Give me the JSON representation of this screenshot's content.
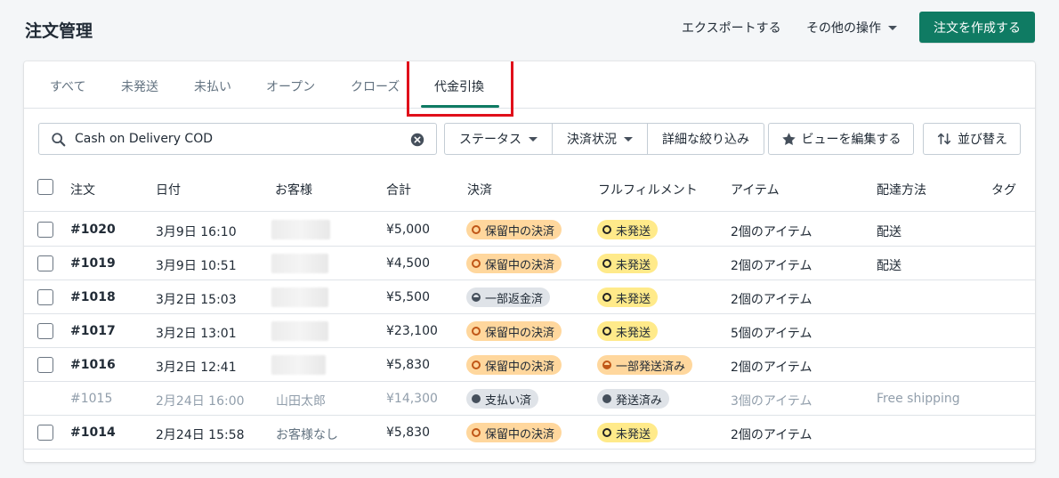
{
  "header": {
    "title": "注文管理",
    "export_label": "エクスポートする",
    "more_actions_label": "その他の操作",
    "create_label": "注文を作成する"
  },
  "tabs": [
    {
      "label": "すべて"
    },
    {
      "label": "未発送"
    },
    {
      "label": "未払い"
    },
    {
      "label": "オープン"
    },
    {
      "label": "クローズ"
    },
    {
      "label": "代金引換"
    }
  ],
  "active_tab": "代金引換",
  "filters": {
    "search_value": "Cash on Delivery COD",
    "status_label": "ステータス",
    "payment_status_label": "決済状況",
    "more_filters_label": "詳細な絞り込み",
    "edit_view_label": "ビューを編集する",
    "sort_label": "並び替え"
  },
  "columns": [
    "注文",
    "日付",
    "お客様",
    "合計",
    "決済",
    "フルフィルメント",
    "アイテム",
    "配達方法",
    "タグ"
  ],
  "orders": [
    {
      "id": "#1020",
      "date": "3月9日 16:10",
      "customer": "",
      "total": "¥5,000",
      "payment": "保留中の決済",
      "fulfillment": "未発送",
      "items": "2個のアイテム",
      "delivery": "配送"
    },
    {
      "id": "#1019",
      "date": "3月9日 10:51",
      "customer": "",
      "total": "¥4,500",
      "payment": "保留中の決済",
      "fulfillment": "未発送",
      "items": "2個のアイテム",
      "delivery": "配送"
    },
    {
      "id": "#1018",
      "date": "3月2日 15:03",
      "customer": "",
      "total": "¥5,500",
      "payment": "一部返金済",
      "fulfillment": "未発送",
      "items": "2個のアイテム",
      "delivery": ""
    },
    {
      "id": "#1017",
      "date": "3月2日 13:01",
      "customer": "",
      "total": "¥23,100",
      "payment": "保留中の決済",
      "fulfillment": "未発送",
      "items": "5個のアイテム",
      "delivery": ""
    },
    {
      "id": "#1016",
      "date": "3月2日 12:41",
      "customer": "",
      "total": "¥5,830",
      "payment": "保留中の決済",
      "fulfillment": "一部発送済み",
      "items": "2個のアイテム",
      "delivery": ""
    },
    {
      "id": "#1015",
      "date": "2月24日 16:00",
      "customer": "山田太郎",
      "total": "¥14,300",
      "payment": "支払い済",
      "fulfillment": "発送済み",
      "items": "3個のアイテム",
      "delivery": "Free shipping"
    },
    {
      "id": "#1014",
      "date": "2月24日 15:58",
      "customer": "お客様なし",
      "total": "¥5,830",
      "payment": "保留中の決済",
      "fulfillment": "未発送",
      "items": "2個のアイテム",
      "delivery": ""
    }
  ],
  "colors": {
    "primary": "#0f7b63",
    "highlight": "#e0101a",
    "pending_badge": "#ffd79d",
    "unfulfilled_badge": "#ffea8a",
    "neutral_badge": "#dfe3e8"
  }
}
